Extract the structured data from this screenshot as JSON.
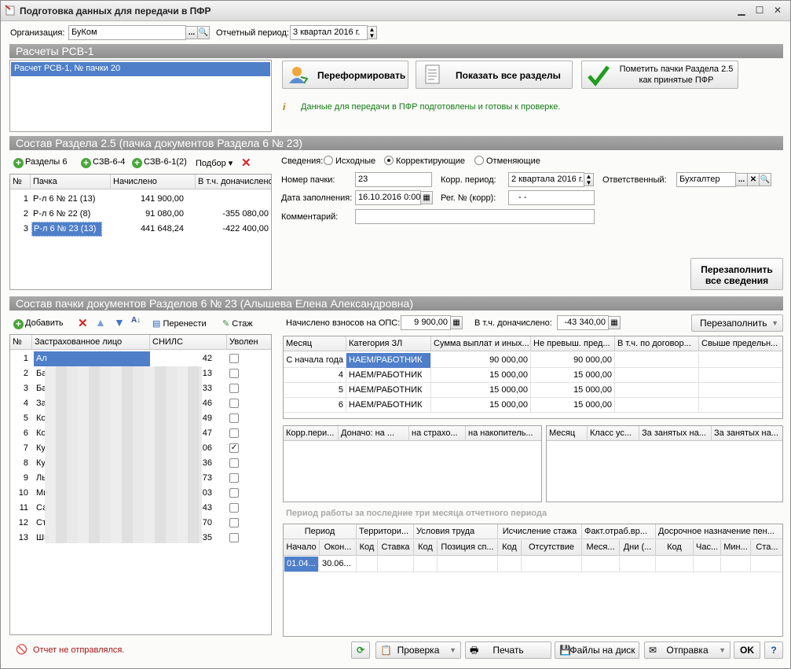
{
  "window": {
    "title": "Подготовка данных для передачи в ПФР"
  },
  "top": {
    "org_label": "Организация:",
    "org_value": "БуКом",
    "period_label": "Отчетный период:",
    "period_value": "3 квартал 2016 г."
  },
  "rsv": {
    "section": "Расчеты РСВ-1",
    "list": [
      "Расчет РСВ-1, № пачки 20"
    ],
    "reform_btn": "Переформировать",
    "show_btn": "Показать все разделы",
    "mark_btn_l1": "Пометить пачки Раздела 2.5",
    "mark_btn_l2": "как принятые ПФР",
    "info": "Данные для передачи в ПФР подготовлены и готовы к проверке."
  },
  "sec25": {
    "section": "Состав Раздела 2.5     (пачка документов Раздела 6 № 23)",
    "toolbar": {
      "r6": "Разделы 6",
      "szv64": "СЗВ-6-4",
      "szv612": "СЗВ-6-1(2)",
      "podbor": "Подбор ▾"
    },
    "cols": [
      "№",
      "Пачка",
      "Начислено",
      "В т.ч. доначислено"
    ],
    "rows": [
      {
        "n": "1",
        "p": "Р-л 6 № 21 (13)",
        "a": "141 900,00",
        "b": ""
      },
      {
        "n": "2",
        "p": "Р-л 6 № 22 (8)",
        "a": "91 080,00",
        "b": "-355 080,00"
      },
      {
        "n": "3",
        "p": "Р-л 6 № 23 (13)",
        "a": "441 648,24",
        "b": "-422 400,00"
      }
    ],
    "info": {
      "sved_label": "Сведения:",
      "opt1": "Исходные",
      "opt2": "Корректирующие",
      "opt3": "Отменяющие",
      "num_label": "Номер пачки:",
      "num_value": "23",
      "korr_label": "Корр. период:",
      "korr_value": "2 квартала 2016 г.",
      "resp_label": "Ответственный:",
      "resp_value": "Бухгалтер",
      "date_label": "Дата заполнения:",
      "date_value": "16.10.2016  0:00",
      "reg_label": "Рег. № (корр):",
      "reg_value": "-   -",
      "comment_label": "Комментарий:",
      "refill_l1": "Перезаполнить",
      "refill_l2": "все сведения"
    }
  },
  "sec6": {
    "section": "Состав пачки документов Разделов 6 № 23          (Алышева Елена Александровна)",
    "toolbar": {
      "add": "Добавить",
      "move": "Перенести",
      "stazh": "Стаж"
    },
    "cols": [
      "№",
      "Застрахованное лицо",
      "СНИЛС",
      "Уволен"
    ],
    "rows": [
      {
        "n": "1",
        "fio": "Ал",
        "snils": "42",
        "fired": false
      },
      {
        "n": "2",
        "fio": "Ба",
        "snils": "13",
        "fired": false
      },
      {
        "n": "3",
        "fio": "Ба",
        "snils": "33",
        "fired": false
      },
      {
        "n": "4",
        "fio": "За",
        "snils": "46",
        "fired": false
      },
      {
        "n": "5",
        "fio": "Ко",
        "snils": "49",
        "fired": false
      },
      {
        "n": "6",
        "fio": "Ко",
        "snils": "47",
        "fired": false
      },
      {
        "n": "7",
        "fio": "Ку",
        "snils": "06",
        "fired": true
      },
      {
        "n": "8",
        "fio": "Ку",
        "snils": "36",
        "fired": false
      },
      {
        "n": "9",
        "fio": "Ль",
        "snils": "73",
        "fired": false
      },
      {
        "n": "10",
        "fio": "Ми",
        "snils": "03",
        "fired": false
      },
      {
        "n": "11",
        "fio": "Са",
        "snils": "43",
        "fired": false
      },
      {
        "n": "12",
        "fio": "Ст",
        "snils": "70",
        "fired": false
      },
      {
        "n": "13",
        "fio": "Ши",
        "snils": "35",
        "fired": false
      }
    ],
    "ops_label": "Начислено взносов на ОПС:",
    "ops_value": "9 900,00",
    "don_label": "В т.ч. доначислено:",
    "don_value": "-43 340,00",
    "refill_btn": "Перезаполнить",
    "pay_cols": [
      "Месяц",
      "Категория ЗЛ",
      "Сумма выплат и иных...",
      "Не превыш. пред...",
      "В т.ч. по договор...",
      "Свыше предельн..."
    ],
    "pay_rows": [
      {
        "m": "С начала года",
        "c": "НАЕМ/РАБОТНИК",
        "s": "90 000,00",
        "n": "90 000,00"
      },
      {
        "m": "4",
        "c": "НАЕМ/РАБОТНИК",
        "s": "15 000,00",
        "n": "15 000,00"
      },
      {
        "m": "5",
        "c": "НАЕМ/РАБОТНИК",
        "s": "15 000,00",
        "n": "15 000,00"
      },
      {
        "m": "6",
        "c": "НАЕМ/РАБОТНИК",
        "s": "15 000,00",
        "n": "15 000,00"
      }
    ],
    "korr_cols": [
      "Корр.пери...",
      "Доначо: на ...",
      "на страхо...",
      "на накопитель..."
    ],
    "dop_cols": [
      "Месяц",
      "Класс ус...",
      "За занятых на...",
      "За занятых на..."
    ],
    "period_title": "Период работы за последние три месяца отчетного периода",
    "st_groups": [
      "Период",
      "Территори...",
      "Условия труда",
      "Исчисление стажа",
      "Факт.отраб.вр...",
      "Досрочное назначение пен..."
    ],
    "st_cols": [
      "Начало",
      "Окон...",
      "Код",
      "Ставка",
      "Код",
      "Позиция сп...",
      "Код",
      "Отсутствие",
      "Меся...",
      "Дни (...",
      "Код",
      "Час...",
      "Мин...",
      "Ста..."
    ],
    "st_row": {
      "start": "01.04...",
      "end": "30.06..."
    }
  },
  "footer": {
    "status": "Отчет не отправлялся.",
    "check": "Проверка",
    "print": "Печать",
    "files": "Файлы на диск",
    "send": "Отправка",
    "ok": "OK"
  }
}
